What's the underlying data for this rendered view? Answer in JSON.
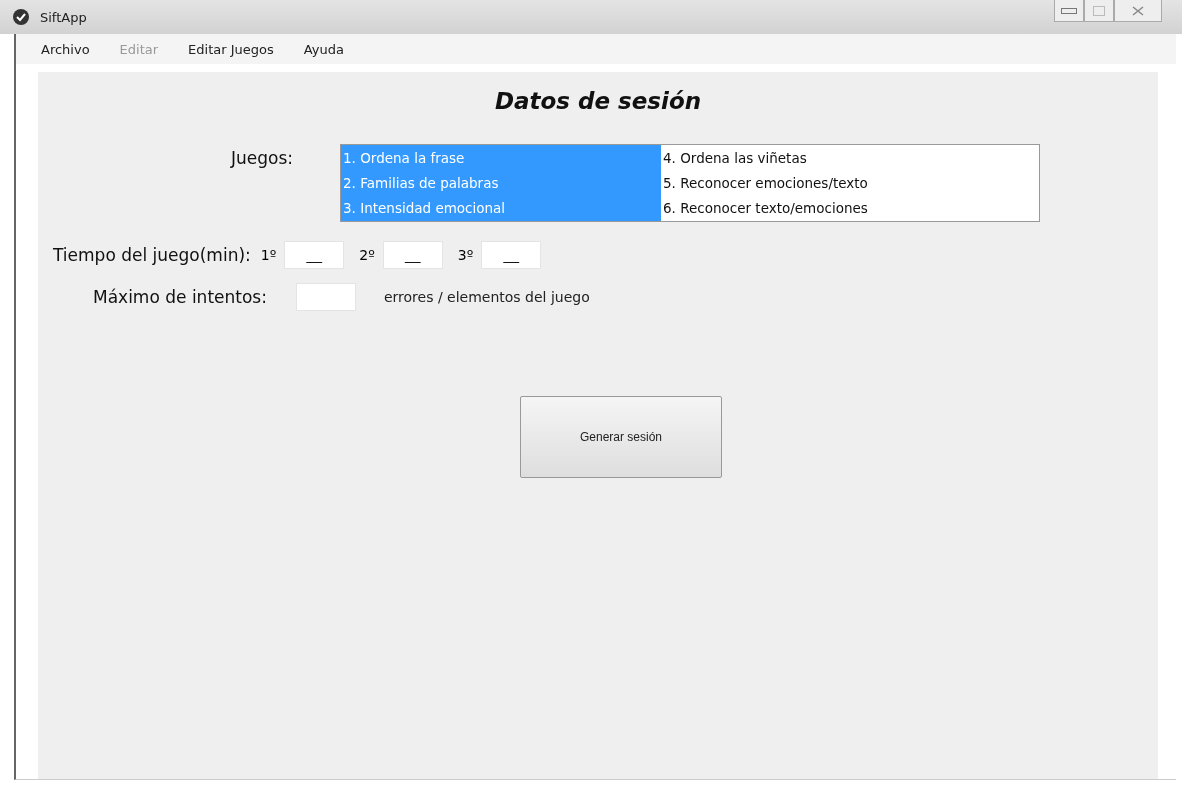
{
  "window": {
    "title": "SiftApp"
  },
  "menu": [
    {
      "label": "Archivo",
      "disabled": false
    },
    {
      "label": "Editar",
      "disabled": true
    },
    {
      "label": "Editar Juegos",
      "disabled": false
    },
    {
      "label": "Ayuda",
      "disabled": false
    }
  ],
  "heading": "Datos de sesión",
  "games": {
    "label": "Juegos:",
    "items": [
      {
        "label": "1. Ordena la frase",
        "selected": true
      },
      {
        "label": "2. Familias de palabras",
        "selected": true
      },
      {
        "label": "3. Intensidad emocional",
        "selected": true
      },
      {
        "label": "4. Ordena las viñetas",
        "selected": false
      },
      {
        "label": "5. Reconocer emociones/texto",
        "selected": false
      },
      {
        "label": "6. Reconocer texto/emociones",
        "selected": false
      }
    ]
  },
  "time": {
    "label": "Tiempo del juego(min):",
    "fields": [
      {
        "label": "1º",
        "value": "__"
      },
      {
        "label": "2º",
        "value": "__"
      },
      {
        "label": "3º",
        "value": "__"
      }
    ]
  },
  "attempts": {
    "label": "Máximo de intentos:",
    "suffix": "errores / elementos del juego"
  },
  "button": "Generar sesión"
}
